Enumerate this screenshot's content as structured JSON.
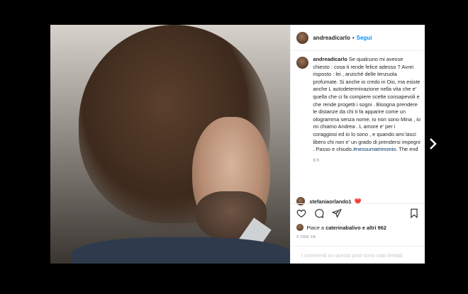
{
  "post": {
    "username": "andreadicarlo",
    "separator": "•",
    "follow_label": "Segui",
    "caption_text": "Se qualcuno mi avesse chiesto : cosa ti rende felice adesso ? Avrei risposto : lei , anziché delle lenzuola profumate. Si anche io credo in Dio, ma esiste anche L autodeterminazione nella vita che e' quella che ci fa compiere scelte consapevoli e che rende progetti i sogni . Bisogna prendere le distanze da chi ti fa apparire come un ologramma senza nome, io non sono Mina , io mi chiamo Andrea . L amore e' per i coraggiosi ed io lo sono , e quando ami lasci libero chi non e' un grado di prendersi impegni . Passo e chiudo.",
    "hashtag": "#nessumatrimonio",
    "caption_end": ". The end",
    "caption_time": "6 h",
    "reply_username": "stefaniaorlando1",
    "reply_emoji": "❤️",
    "likes_prefix": "Piace a ",
    "likes_user": "caterinabalivo",
    "likes_suffix": " e altri 962",
    "posted_ago": "6 ORE FA",
    "comments_limited": "I commenti su questo post sono stati limitati."
  },
  "icons": {
    "like": "heart-icon",
    "comment": "comment-icon",
    "share": "share-icon",
    "save": "bookmark-icon",
    "next": "chevron-right-icon"
  },
  "colors": {
    "backdrop": "#000000",
    "follow": "#0095f6",
    "hashtag": "#00376b",
    "muted": "#8e8e8e"
  }
}
